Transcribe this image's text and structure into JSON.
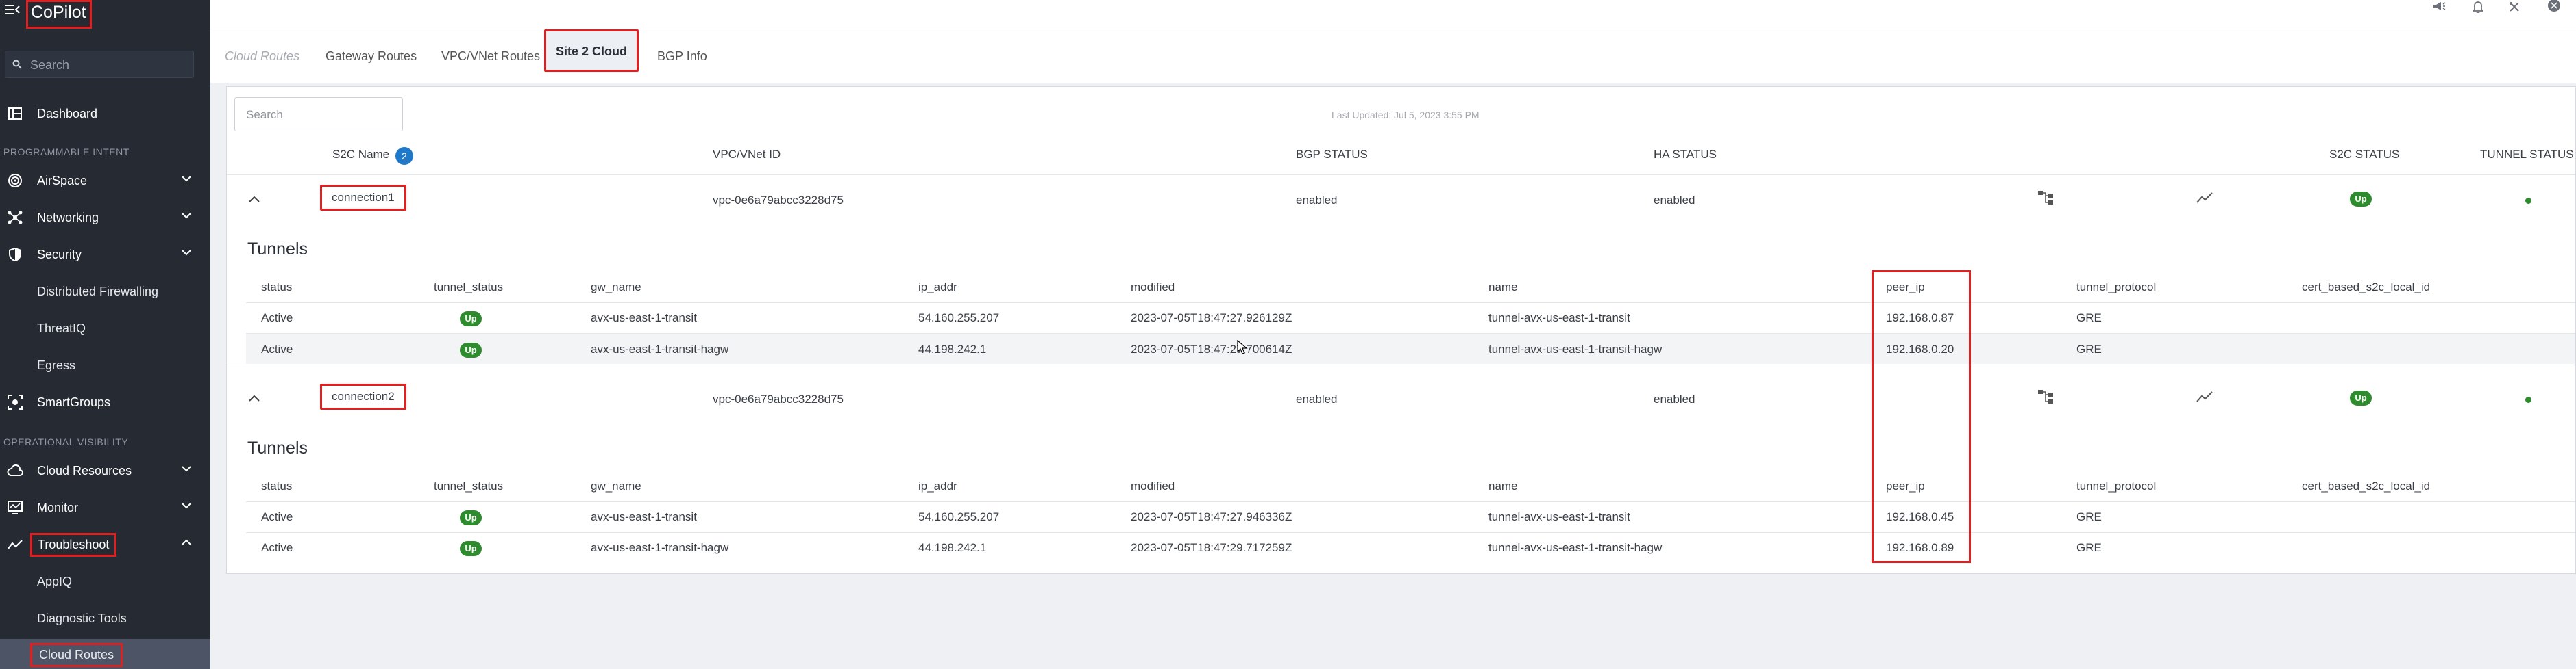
{
  "app": {
    "brand": "CoPilot"
  },
  "sidebar": {
    "search_placeholder": "Search",
    "dashboard": "Dashboard",
    "section_programmable": "PROGRAMMABLE INTENT",
    "airspace": "AirSpace",
    "networking": "Networking",
    "security": "Security",
    "security_children": [
      "Distributed Firewalling",
      "ThreatIQ",
      "Egress"
    ],
    "smartgroups": "SmartGroups",
    "section_operational": "OPERATIONAL VISIBILITY",
    "cloud_resources": "Cloud Resources",
    "monitor": "Monitor",
    "troubleshoot": "Troubleshoot",
    "troubleshoot_children": [
      "AppIQ",
      "Diagnostic Tools",
      "Cloud Routes"
    ]
  },
  "tabs": [
    "Cloud Routes",
    "Gateway Routes",
    "VPC/VNet Routes",
    "Site 2 Cloud",
    "BGP Info"
  ],
  "panel": {
    "search_placeholder": "Search",
    "last_updated": "Last Updated: Jul 5, 2023 3:55 PM",
    "columns": {
      "s2c_name": "S2C Name",
      "count": "2",
      "vpc": "VPC/VNet ID",
      "bgp": "BGP STATUS",
      "ha": "HA STATUS",
      "s2c_status": "S2C STATUS",
      "tunnel_status": "TUNNEL STATUS"
    },
    "tunnels_title": "Tunnels",
    "tunnel_columns": [
      "status",
      "tunnel_status",
      "gw_name",
      "ip_addr",
      "modified",
      "name",
      "peer_ip",
      "tunnel_protocol",
      "cert_based_s2c_local_id"
    ],
    "connections": [
      {
        "name": "connection1",
        "vpc": "vpc-0e6a79abcc3228d75",
        "bgp": "enabled",
        "ha": "enabled",
        "s2c": "Up",
        "tunnels": [
          {
            "status": "Active",
            "tunnel_status": "Up",
            "gw_name": "avx-us-east-1-transit",
            "ip_addr": "54.160.255.207",
            "modified": "2023-07-05T18:47:27.926129Z",
            "name": "tunnel-avx-us-east-1-transit",
            "peer_ip": "192.168.0.87",
            "protocol": "GRE"
          },
          {
            "status": "Active",
            "tunnel_status": "Up",
            "gw_name": "avx-us-east-1-transit-hagw",
            "ip_addr": "44.198.242.1",
            "modified": "2023-07-05T18:47:2​7.700614Z",
            "name": "tunnel-avx-us-east-1-transit-hagw",
            "peer_ip": "192.168.0.20",
            "protocol": "GRE"
          }
        ]
      },
      {
        "name": "connection2",
        "vpc": "vpc-0e6a79abcc3228d75",
        "bgp": "enabled",
        "ha": "enabled",
        "s2c": "Up",
        "tunnels": [
          {
            "status": "Active",
            "tunnel_status": "Up",
            "gw_name": "avx-us-east-1-transit",
            "ip_addr": "54.160.255.207",
            "modified": "2023-07-05T18:47:27.946336Z",
            "name": "tunnel-avx-us-east-1-transit",
            "peer_ip": "192.168.0.45",
            "protocol": "GRE"
          },
          {
            "status": "Active",
            "tunnel_status": "Up",
            "gw_name": "avx-us-east-1-transit-hagw",
            "ip_addr": "44.198.242.1",
            "modified": "2023-07-05T18:47:29.717259Z",
            "name": "tunnel-avx-us-east-1-transit-hagw",
            "peer_ip": "192.168.0.89",
            "protocol": "GRE"
          }
        ]
      }
    ]
  },
  "colors": {
    "sidebar_bg": "#252a33",
    "accent_red": "#e02020",
    "status_green": "#2e8b2e",
    "badge_blue": "#1f78c8"
  }
}
